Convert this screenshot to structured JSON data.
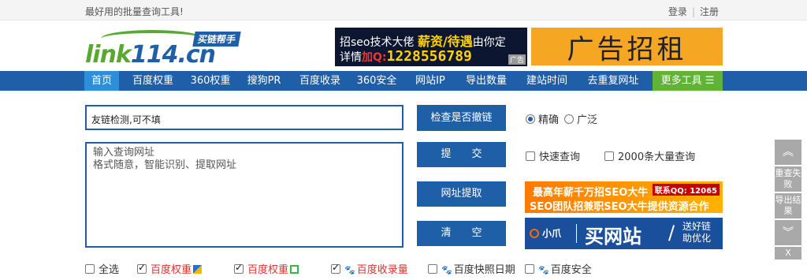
{
  "topbar": {
    "slogan": "最好用的批量查询工具!",
    "login": "登录",
    "register": "注册"
  },
  "logo": {
    "text_green": "link",
    "text_blue": "114.cn",
    "tag": "买链帮手"
  },
  "ads": {
    "ad1_line1_a": "招seo技术大佬 ",
    "ad1_line1_b": "薪资/待遇",
    "ad1_line1_c": "由你定",
    "ad1_line2_a": "详情",
    "ad1_line2_b": "加Q:",
    "ad1_line2_c": "1228556789",
    "ad1_badge": "广告",
    "ad2": "广告招租",
    "ad3_line1": "最高年薪千万招SEO大牛",
    "ad3_line2": "SEO团队招兼职SEO大牛提供资源合作",
    "ad3_qq": "联系QQ: 12065",
    "ad4_brand": "小爪",
    "ad4_big": "买网站",
    "ad4_small1": "送好链",
    "ad4_small2": "助优化"
  },
  "nav": {
    "items": [
      "首页",
      "百度权重",
      "360权重",
      "搜狗PR",
      "百度收录",
      "360安全",
      "网站IP",
      "导出数量",
      "建站时间",
      "去重复网址"
    ],
    "more": "更多工具 ☰"
  },
  "form": {
    "link_input_value": "友链检测,可不填",
    "url_line1": "输入查询网址",
    "url_line2": "格式随意，智能识别、提取网址",
    "btn_check": "检查是否撤链",
    "btn_submit": "提　　交",
    "btn_extract": "网址提取",
    "btn_clear": "清　　空",
    "radio_exact": "精确",
    "radio_broad": "广泛",
    "chk_fast": "快速查询",
    "chk_bulk": "2000条大量查询"
  },
  "bottom_checks": {
    "select_all": "全选",
    "baidu_weight": "百度权重",
    "baidu_weight2": "百度权重",
    "baidu_index": "百度收录量",
    "baidu_snapshot": "百度快照日期",
    "baidu_security": "百度安全"
  },
  "sidebar": {
    "retry_failed": "重查失败",
    "export_result": "导出结果",
    "close": "X"
  }
}
